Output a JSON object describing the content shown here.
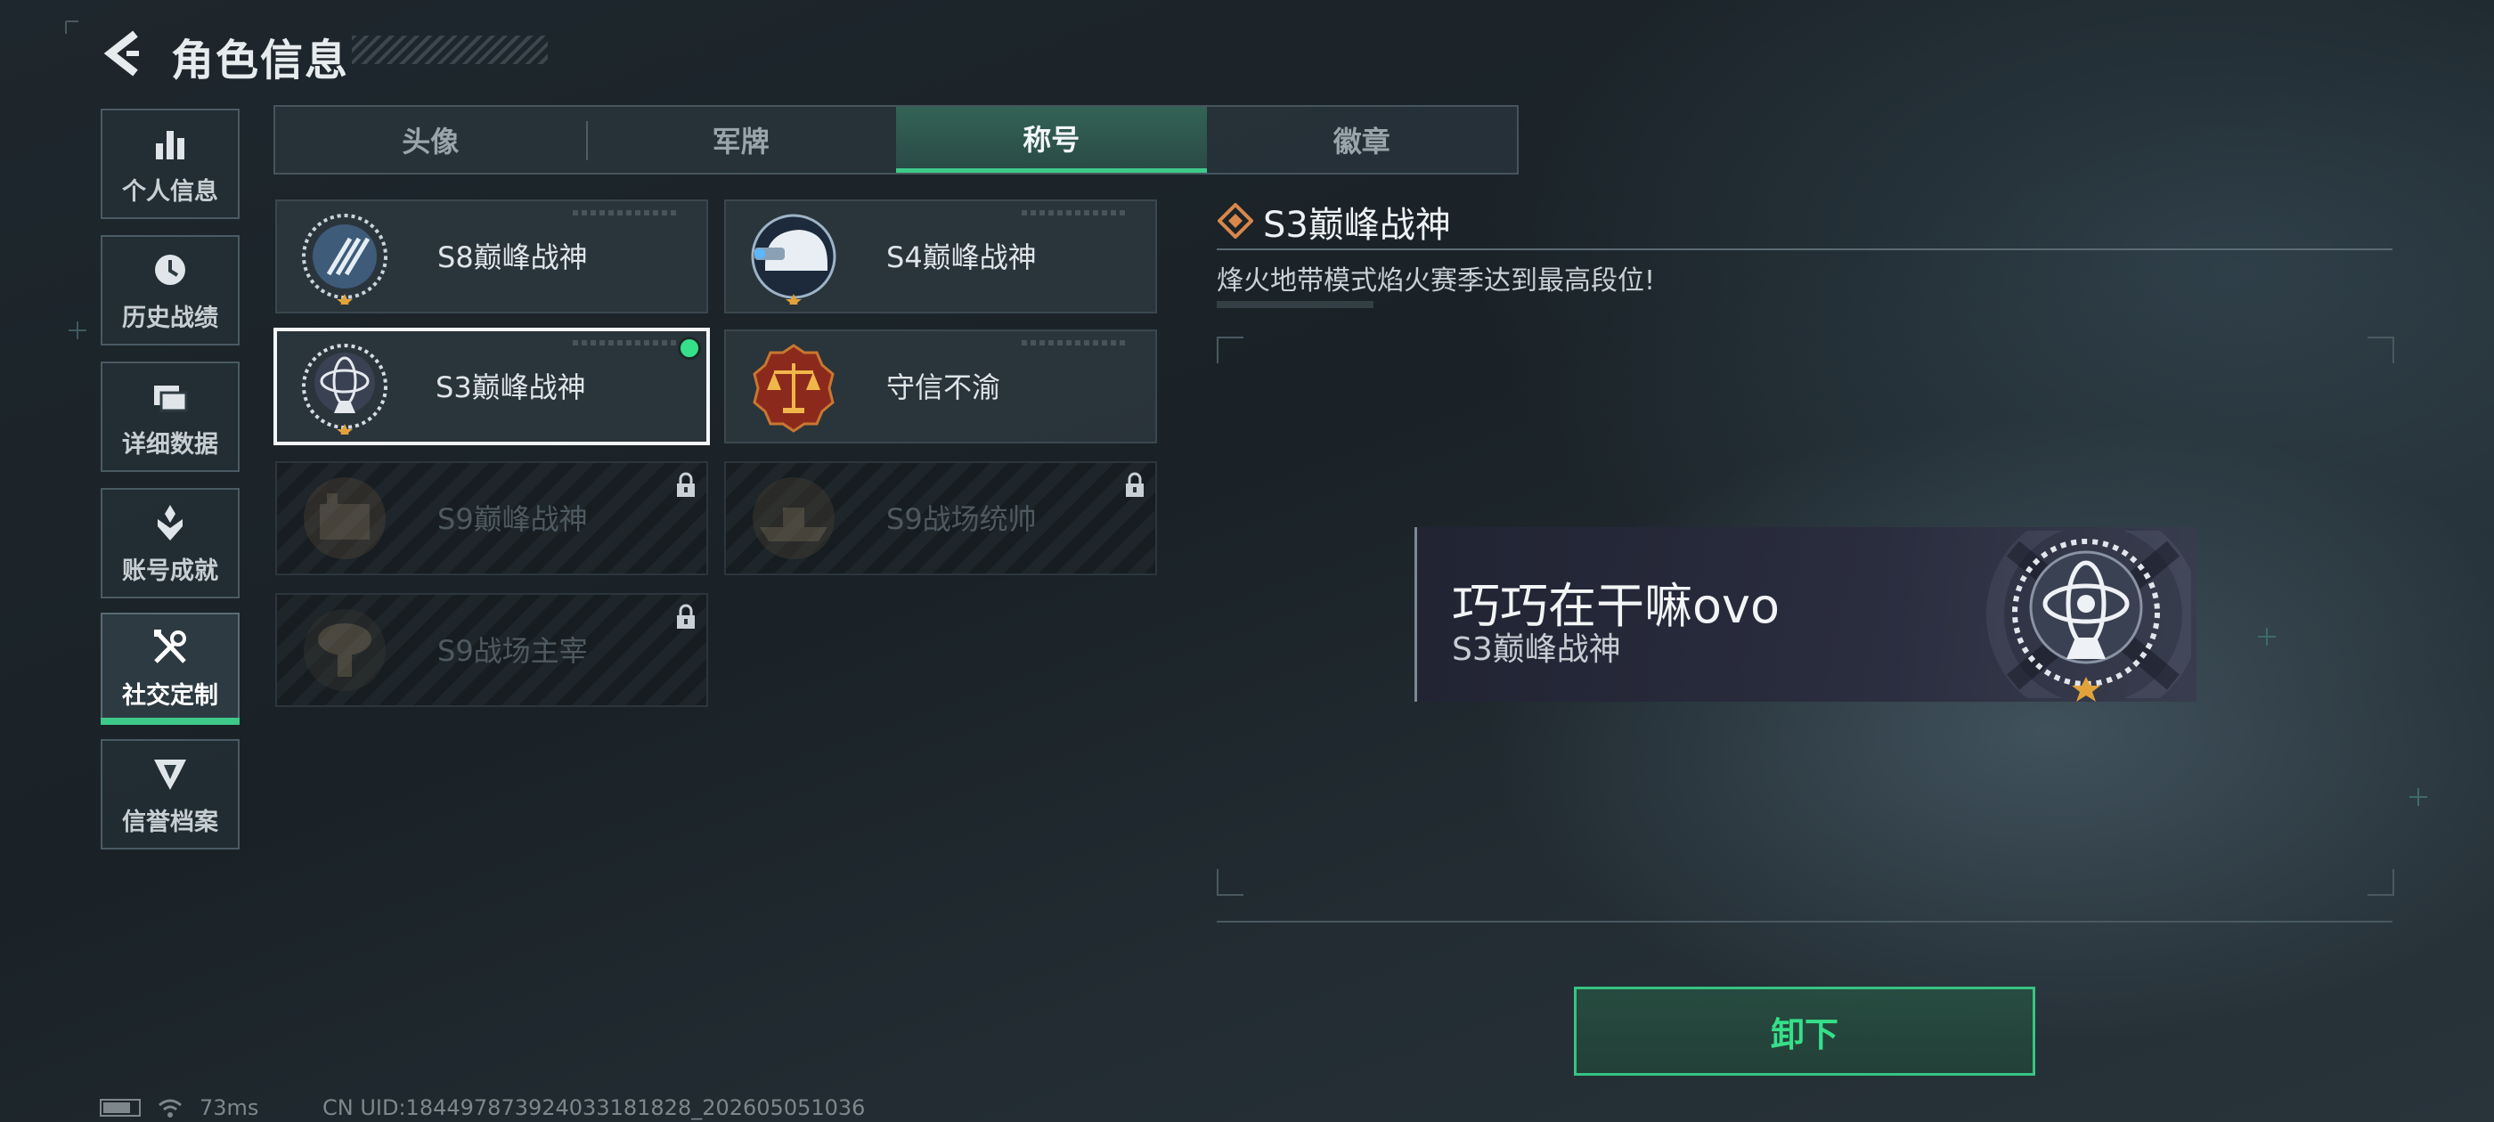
{
  "header": {
    "title": "角色信息"
  },
  "sidebar": {
    "items": [
      {
        "label": "个人信息",
        "icon": "bar-chart-icon"
      },
      {
        "label": "历史战绩",
        "icon": "clock-icon"
      },
      {
        "label": "详细数据",
        "icon": "folder-icon"
      },
      {
        "label": "账号成就",
        "icon": "achievement-icon"
      },
      {
        "label": "社交定制",
        "icon": "tools-icon",
        "active": true
      },
      {
        "label": "信誉档案",
        "icon": "shield-icon"
      }
    ]
  },
  "tabs": [
    {
      "label": "头像"
    },
    {
      "label": "军牌"
    },
    {
      "label": "称号",
      "active": true
    },
    {
      "label": "徽章"
    }
  ],
  "titles": [
    {
      "name": "S8巅峰战神",
      "icon": "s8-peak-badge-icon",
      "locked": false
    },
    {
      "name": "S4巅峰战神",
      "icon": "helmet-badge-icon",
      "locked": false
    },
    {
      "name": "S3巅峰战神",
      "icon": "armillary-badge-icon",
      "locked": false,
      "selected": true
    },
    {
      "name": "守信不渝",
      "icon": "scales-badge-icon",
      "locked": false
    },
    {
      "name": "S9巅峰战神",
      "icon": "building-badge-icon",
      "locked": true
    },
    {
      "name": "S9战场统帅",
      "icon": "warship-badge-icon",
      "locked": true
    },
    {
      "name": "S9战场主宰",
      "icon": "mushroom-cloud-badge-icon",
      "locked": true
    }
  ],
  "detail": {
    "title": "S3巅峰战神",
    "description": "烽火地带模式焰火赛季达到最高段位!"
  },
  "preview": {
    "player_name": "巧巧在干嘛ovo",
    "title": "S3巅峰战神"
  },
  "actions": {
    "unequip_label": "卸下"
  },
  "status": {
    "ping": "73ms",
    "uid": "CN UID:184497873924033181828_202605051036"
  },
  "colors": {
    "accent": "#3ec98a",
    "selected_dot": "#36e08a",
    "detail_icon": "#d9874a"
  }
}
